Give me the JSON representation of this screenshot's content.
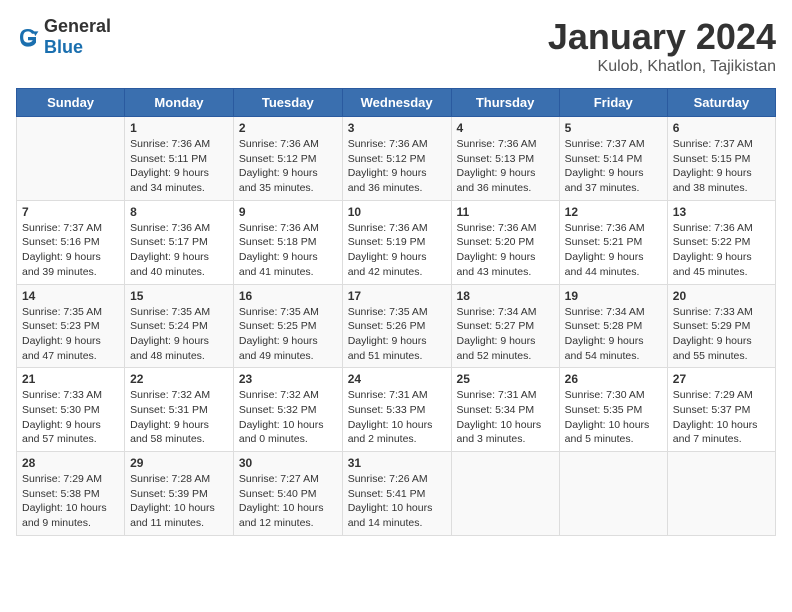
{
  "header": {
    "logo_general": "General",
    "logo_blue": "Blue",
    "month_title": "January 2024",
    "location": "Kulob, Khatlon, Tajikistan"
  },
  "days_of_week": [
    "Sunday",
    "Monday",
    "Tuesday",
    "Wednesday",
    "Thursday",
    "Friday",
    "Saturday"
  ],
  "weeks": [
    [
      {
        "day": "",
        "sunrise": "",
        "sunset": "",
        "daylight": ""
      },
      {
        "day": "1",
        "sunrise": "Sunrise: 7:36 AM",
        "sunset": "Sunset: 5:11 PM",
        "daylight": "Daylight: 9 hours and 34 minutes."
      },
      {
        "day": "2",
        "sunrise": "Sunrise: 7:36 AM",
        "sunset": "Sunset: 5:12 PM",
        "daylight": "Daylight: 9 hours and 35 minutes."
      },
      {
        "day": "3",
        "sunrise": "Sunrise: 7:36 AM",
        "sunset": "Sunset: 5:12 PM",
        "daylight": "Daylight: 9 hours and 36 minutes."
      },
      {
        "day": "4",
        "sunrise": "Sunrise: 7:36 AM",
        "sunset": "Sunset: 5:13 PM",
        "daylight": "Daylight: 9 hours and 36 minutes."
      },
      {
        "day": "5",
        "sunrise": "Sunrise: 7:37 AM",
        "sunset": "Sunset: 5:14 PM",
        "daylight": "Daylight: 9 hours and 37 minutes."
      },
      {
        "day": "6",
        "sunrise": "Sunrise: 7:37 AM",
        "sunset": "Sunset: 5:15 PM",
        "daylight": "Daylight: 9 hours and 38 minutes."
      }
    ],
    [
      {
        "day": "7",
        "sunrise": "Sunrise: 7:37 AM",
        "sunset": "Sunset: 5:16 PM",
        "daylight": "Daylight: 9 hours and 39 minutes."
      },
      {
        "day": "8",
        "sunrise": "Sunrise: 7:36 AM",
        "sunset": "Sunset: 5:17 PM",
        "daylight": "Daylight: 9 hours and 40 minutes."
      },
      {
        "day": "9",
        "sunrise": "Sunrise: 7:36 AM",
        "sunset": "Sunset: 5:18 PM",
        "daylight": "Daylight: 9 hours and 41 minutes."
      },
      {
        "day": "10",
        "sunrise": "Sunrise: 7:36 AM",
        "sunset": "Sunset: 5:19 PM",
        "daylight": "Daylight: 9 hours and 42 minutes."
      },
      {
        "day": "11",
        "sunrise": "Sunrise: 7:36 AM",
        "sunset": "Sunset: 5:20 PM",
        "daylight": "Daylight: 9 hours and 43 minutes."
      },
      {
        "day": "12",
        "sunrise": "Sunrise: 7:36 AM",
        "sunset": "Sunset: 5:21 PM",
        "daylight": "Daylight: 9 hours and 44 minutes."
      },
      {
        "day": "13",
        "sunrise": "Sunrise: 7:36 AM",
        "sunset": "Sunset: 5:22 PM",
        "daylight": "Daylight: 9 hours and 45 minutes."
      }
    ],
    [
      {
        "day": "14",
        "sunrise": "Sunrise: 7:35 AM",
        "sunset": "Sunset: 5:23 PM",
        "daylight": "Daylight: 9 hours and 47 minutes."
      },
      {
        "day": "15",
        "sunrise": "Sunrise: 7:35 AM",
        "sunset": "Sunset: 5:24 PM",
        "daylight": "Daylight: 9 hours and 48 minutes."
      },
      {
        "day": "16",
        "sunrise": "Sunrise: 7:35 AM",
        "sunset": "Sunset: 5:25 PM",
        "daylight": "Daylight: 9 hours and 49 minutes."
      },
      {
        "day": "17",
        "sunrise": "Sunrise: 7:35 AM",
        "sunset": "Sunset: 5:26 PM",
        "daylight": "Daylight: 9 hours and 51 minutes."
      },
      {
        "day": "18",
        "sunrise": "Sunrise: 7:34 AM",
        "sunset": "Sunset: 5:27 PM",
        "daylight": "Daylight: 9 hours and 52 minutes."
      },
      {
        "day": "19",
        "sunrise": "Sunrise: 7:34 AM",
        "sunset": "Sunset: 5:28 PM",
        "daylight": "Daylight: 9 hours and 54 minutes."
      },
      {
        "day": "20",
        "sunrise": "Sunrise: 7:33 AM",
        "sunset": "Sunset: 5:29 PM",
        "daylight": "Daylight: 9 hours and 55 minutes."
      }
    ],
    [
      {
        "day": "21",
        "sunrise": "Sunrise: 7:33 AM",
        "sunset": "Sunset: 5:30 PM",
        "daylight": "Daylight: 9 hours and 57 minutes."
      },
      {
        "day": "22",
        "sunrise": "Sunrise: 7:32 AM",
        "sunset": "Sunset: 5:31 PM",
        "daylight": "Daylight: 9 hours and 58 minutes."
      },
      {
        "day": "23",
        "sunrise": "Sunrise: 7:32 AM",
        "sunset": "Sunset: 5:32 PM",
        "daylight": "Daylight: 10 hours and 0 minutes."
      },
      {
        "day": "24",
        "sunrise": "Sunrise: 7:31 AM",
        "sunset": "Sunset: 5:33 PM",
        "daylight": "Daylight: 10 hours and 2 minutes."
      },
      {
        "day": "25",
        "sunrise": "Sunrise: 7:31 AM",
        "sunset": "Sunset: 5:34 PM",
        "daylight": "Daylight: 10 hours and 3 minutes."
      },
      {
        "day": "26",
        "sunrise": "Sunrise: 7:30 AM",
        "sunset": "Sunset: 5:35 PM",
        "daylight": "Daylight: 10 hours and 5 minutes."
      },
      {
        "day": "27",
        "sunrise": "Sunrise: 7:29 AM",
        "sunset": "Sunset: 5:37 PM",
        "daylight": "Daylight: 10 hours and 7 minutes."
      }
    ],
    [
      {
        "day": "28",
        "sunrise": "Sunrise: 7:29 AM",
        "sunset": "Sunset: 5:38 PM",
        "daylight": "Daylight: 10 hours and 9 minutes."
      },
      {
        "day": "29",
        "sunrise": "Sunrise: 7:28 AM",
        "sunset": "Sunset: 5:39 PM",
        "daylight": "Daylight: 10 hours and 11 minutes."
      },
      {
        "day": "30",
        "sunrise": "Sunrise: 7:27 AM",
        "sunset": "Sunset: 5:40 PM",
        "daylight": "Daylight: 10 hours and 12 minutes."
      },
      {
        "day": "31",
        "sunrise": "Sunrise: 7:26 AM",
        "sunset": "Sunset: 5:41 PM",
        "daylight": "Daylight: 10 hours and 14 minutes."
      },
      {
        "day": "",
        "sunrise": "",
        "sunset": "",
        "daylight": ""
      },
      {
        "day": "",
        "sunrise": "",
        "sunset": "",
        "daylight": ""
      },
      {
        "day": "",
        "sunrise": "",
        "sunset": "",
        "daylight": ""
      }
    ]
  ]
}
